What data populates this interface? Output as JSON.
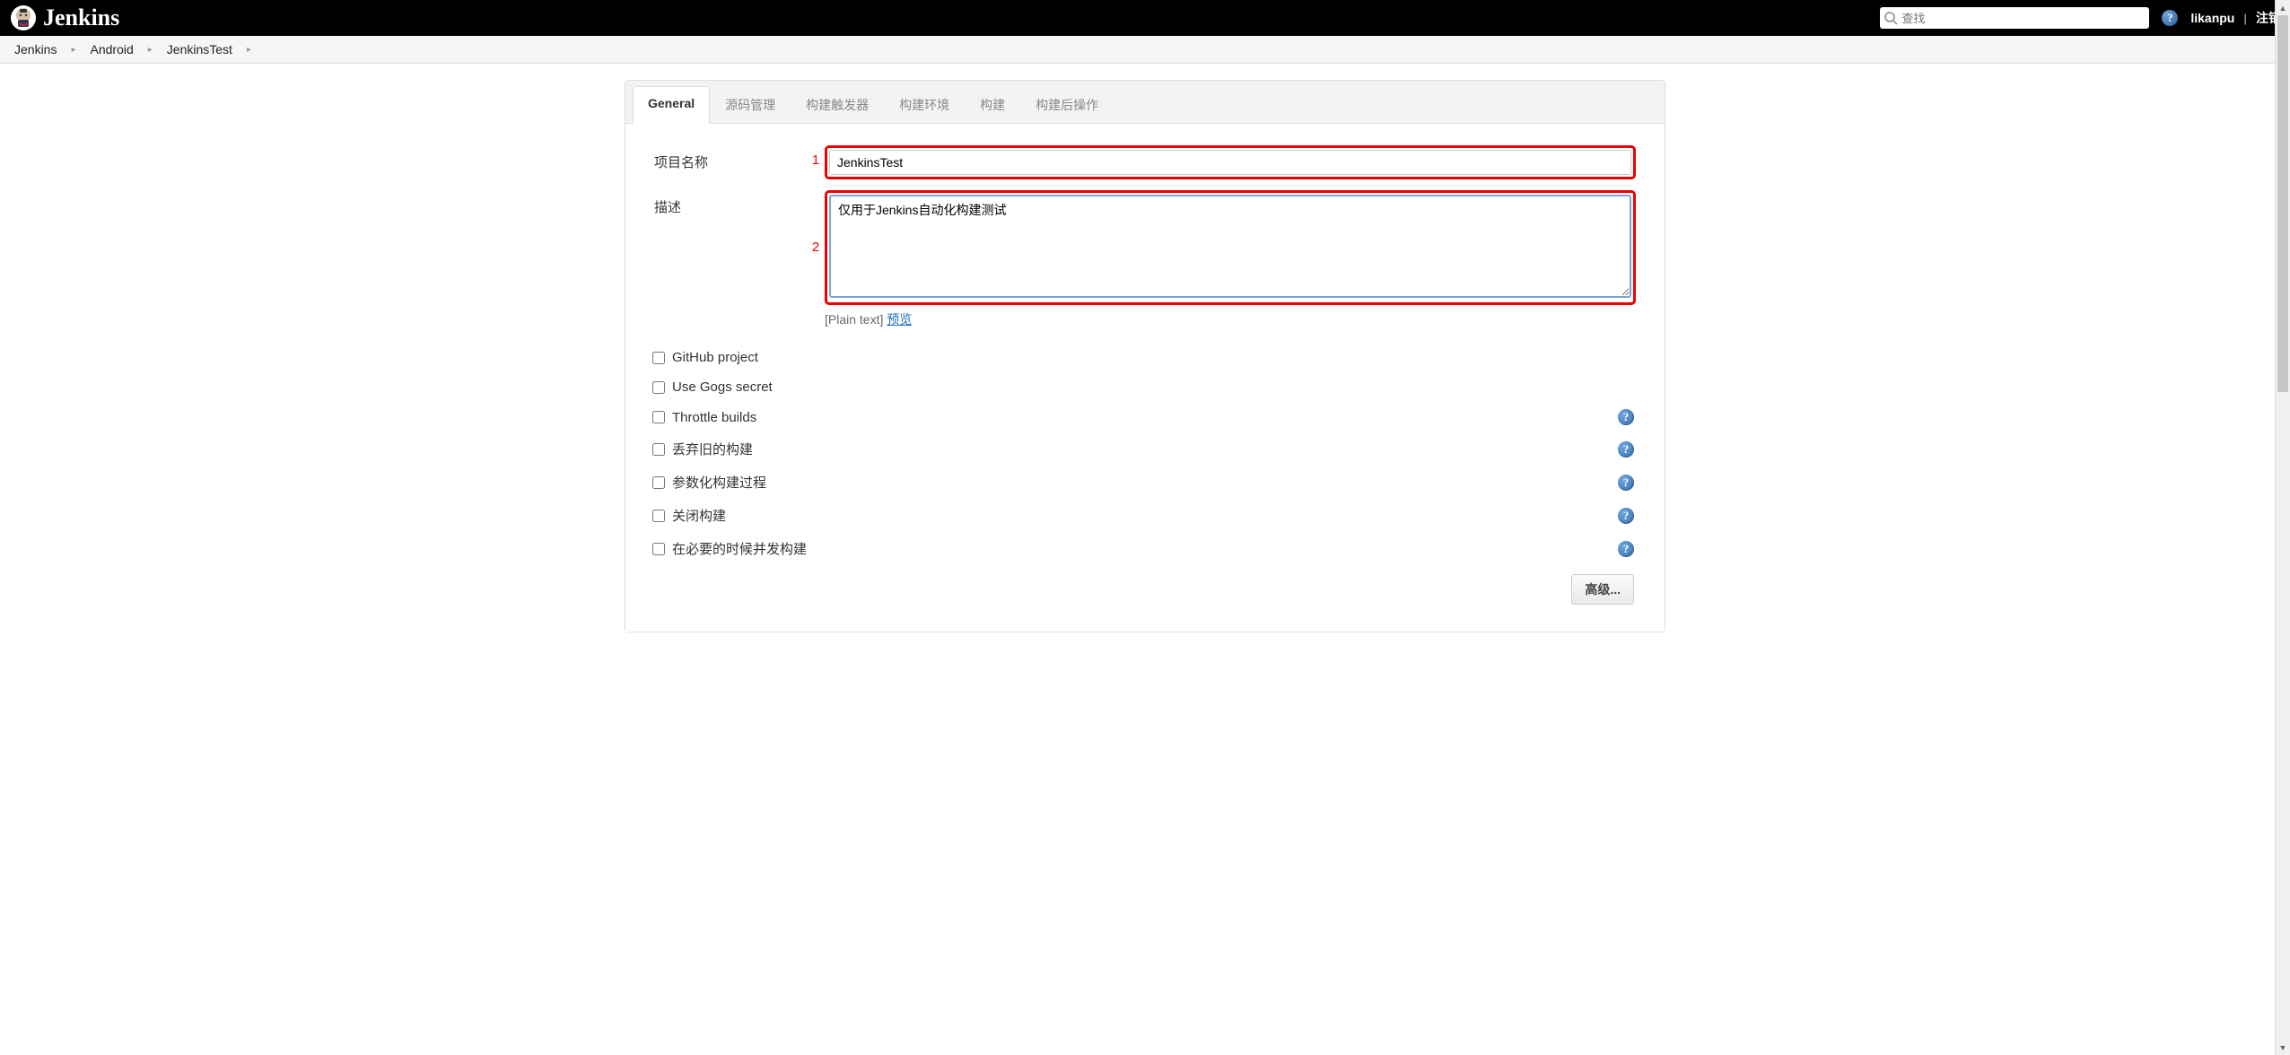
{
  "header": {
    "brand": "Jenkins",
    "search_placeholder": "查找",
    "username": "likanpu",
    "logout": "注销"
  },
  "breadcrumbs": [
    "Jenkins",
    "Android",
    "JenkinsTest"
  ],
  "tabs": [
    {
      "label": "General",
      "active": true
    },
    {
      "label": "源码管理",
      "active": false
    },
    {
      "label": "构建触发器",
      "active": false
    },
    {
      "label": "构建环境",
      "active": false
    },
    {
      "label": "构建",
      "active": false
    },
    {
      "label": "构建后操作",
      "active": false
    }
  ],
  "form": {
    "projectName": {
      "label": "项目名称",
      "value": "JenkinsTest",
      "annotation": "1"
    },
    "description": {
      "label": "描述",
      "value": "仅用于Jenkins自动化构建测试",
      "annotation": "2",
      "footer_format": "[Plain text]",
      "footer_preview": "预览"
    }
  },
  "checkboxes": [
    {
      "label": "GitHub project",
      "help": false
    },
    {
      "label": "Use Gogs secret",
      "help": false
    },
    {
      "label": "Throttle builds",
      "help": true
    },
    {
      "label": "丢弃旧的构建",
      "help": true
    },
    {
      "label": "参数化构建过程",
      "help": true
    },
    {
      "label": "关闭构建",
      "help": true
    },
    {
      "label": "在必要的时候并发构建",
      "help": true
    }
  ],
  "advanced_button": "高级..."
}
